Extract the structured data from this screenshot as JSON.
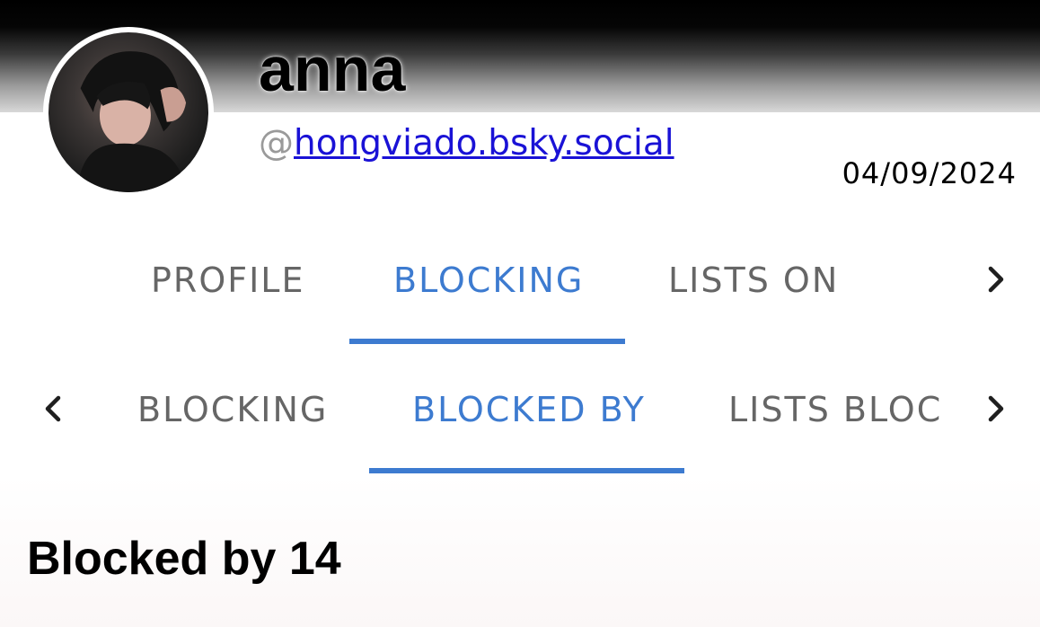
{
  "profile": {
    "display_name": "anna",
    "handle_prefix": "@",
    "handle": "hongviado.bsky.social",
    "date": "04/09/2024"
  },
  "main_tabs": [
    {
      "label": "PROFILE",
      "active": false
    },
    {
      "label": "BLOCKING",
      "active": true
    },
    {
      "label": "LISTS ON",
      "active": false
    }
  ],
  "sub_tabs": [
    {
      "label": "BLOCKING",
      "active": false
    },
    {
      "label": "BLOCKED BY",
      "active": true
    },
    {
      "label": "LISTS BLOC",
      "active": false
    }
  ],
  "content": {
    "title": "Blocked by 14"
  },
  "colors": {
    "accent": "#3d7bd0",
    "tab_inactive": "#666666",
    "link": "#1a12d6"
  },
  "icons": {
    "main_next": "chevron-right-icon",
    "sub_prev": "chevron-left-icon",
    "sub_next": "chevron-right-icon"
  }
}
